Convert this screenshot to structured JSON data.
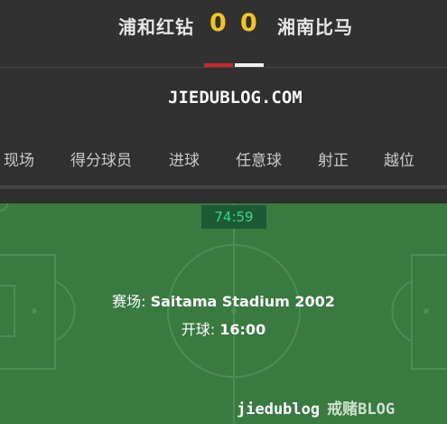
{
  "match": {
    "home_team": "浦和红钻",
    "away_team": "湘南比马",
    "home_score": "0",
    "away_score": "0",
    "home_color": "#c8272e",
    "away_color": "#f2f2f2"
  },
  "watermark": {
    "top": "JIEDUBLOG.COM",
    "bottom_main": "jiedublog",
    "bottom_tail": "戒赌BLOG"
  },
  "tabs": [
    {
      "label": "现场"
    },
    {
      "label": "得分球员"
    },
    {
      "label": "进球"
    },
    {
      "label": "任意球"
    },
    {
      "label": "射正"
    },
    {
      "label": "越位"
    }
  ],
  "pitch": {
    "clock": "74:59",
    "venue_label": "赛场: ",
    "venue": "Saitama Stadium 2002",
    "kickoff_label": "开球: ",
    "kickoff": "16:00"
  }
}
